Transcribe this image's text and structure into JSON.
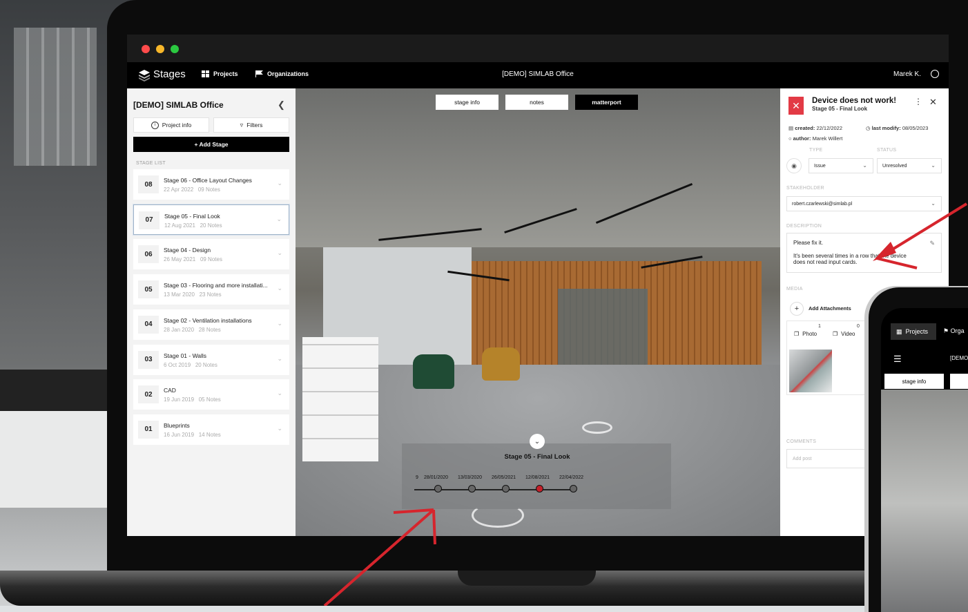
{
  "app": {
    "brand": "Stages",
    "nav": {
      "projects": "Projects",
      "organizations": "Organizations"
    },
    "project_title": "[DEMO] SIMLAB Office",
    "user": "Marek K."
  },
  "sidebar": {
    "title": "[DEMO] SIMLAB Office",
    "project_info": "Project info",
    "filters": "Filters",
    "add_stage": "+ Add Stage",
    "stage_list_label": "STAGE LIST",
    "stages": [
      {
        "num": "08",
        "name": "Stage 06 - Office Layout Changes",
        "date": "22 Apr 2022",
        "notes": "09 Notes"
      },
      {
        "num": "07",
        "name": "Stage 05 - Final Look",
        "date": "12 Aug 2021",
        "notes": "20 Notes"
      },
      {
        "num": "06",
        "name": "Stage 04 - Design",
        "date": "26 May 2021",
        "notes": "09 Notes"
      },
      {
        "num": "05",
        "name": "Stage 03 - Flooring and more installati...",
        "date": "13 Mar 2020",
        "notes": "23 Notes"
      },
      {
        "num": "04",
        "name": "Stage 02 - Ventilation installations",
        "date": "28 Jan 2020",
        "notes": "28 Notes"
      },
      {
        "num": "03",
        "name": "Stage 01 - Walls",
        "date": "6 Oct 2019",
        "notes": "20 Notes"
      },
      {
        "num": "02",
        "name": "CAD",
        "date": "19 Jun 2019",
        "notes": "05 Notes"
      },
      {
        "num": "01",
        "name": "Blueprints",
        "date": "16 Jun 2019",
        "notes": "14 Notes"
      }
    ],
    "selected_index": 1
  },
  "viewer": {
    "tabs": {
      "stage_info": "stage info",
      "notes": "notes",
      "matterport": "matterport"
    },
    "timeline": {
      "title": "Stage 05 - Final Look",
      "lead_label": "9",
      "dates": [
        "28/01/2020",
        "13/03/2020",
        "26/05/2021",
        "12/08/2021",
        "22/04/2022"
      ],
      "active_index": 3
    }
  },
  "panel": {
    "title": "Device does not work!",
    "subtitle": "Stage 05 - Final Look",
    "created_label": "created:",
    "created": "22/12/2022",
    "modified_label": "last modify:",
    "modified": "08/05/2023",
    "author_label": "author:",
    "author": "Marek Willert",
    "type_label": "TYPE",
    "type_value": "Issue",
    "status_label": "STATUS",
    "status_value": "Unresolved",
    "stakeholder_label": "STAKEHOLDER",
    "stakeholder_value": "robert.czarlewski@simlab.pl",
    "description_label": "DESCRIPTION",
    "description_line1": "Please fix it.",
    "description_line2": "It's been several times in a row that the device does not read input cards.",
    "media_label": "MEDIA",
    "add_attachments": "Add Attachments",
    "photo_label": "Photo",
    "photo_count": "1",
    "video_label": "Video",
    "video_count": "0",
    "comments_label": "COMMENTS",
    "comment_placeholder": "Add post"
  },
  "phone": {
    "nav_projects": "Projects",
    "nav_org": "Orga",
    "title": "[DEMO",
    "tab_stage_info": "stage info"
  },
  "colors": {
    "accent_red": "#e23a45",
    "timeline_active": "#c4202a",
    "nav_bg": "#000000"
  }
}
